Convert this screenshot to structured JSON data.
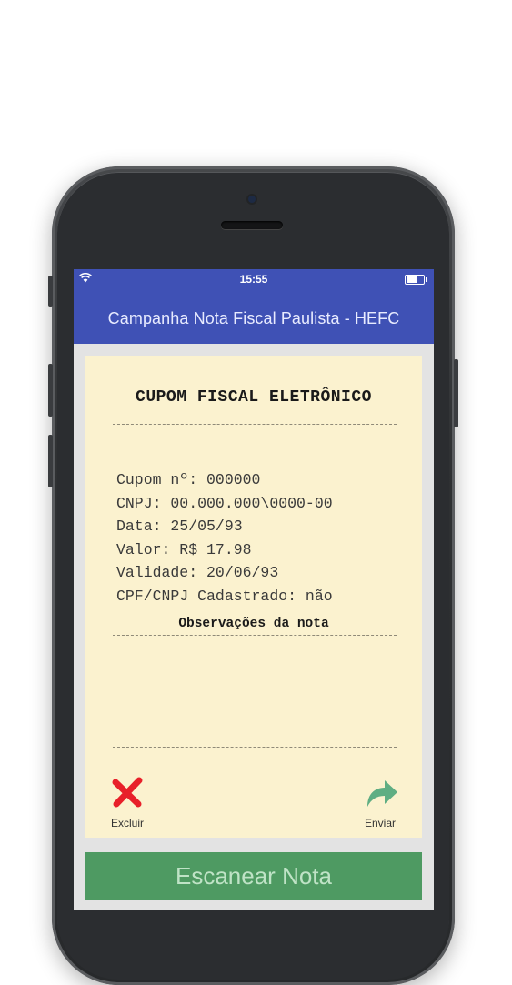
{
  "status_bar": {
    "time": "15:55",
    "icons": [
      "wifi-icon",
      "battery-icon"
    ]
  },
  "app_bar": {
    "title": "Campanha Nota Fiscal Paulista - HEFC"
  },
  "receipt": {
    "title": "CUPOM FISCAL ELETRÔNICO",
    "details": [
      "Cupom nº: 000000",
      "CNPJ: 00.000.000\\0000-00",
      "Data: 25/05/93",
      "Valor: R$ 17.98",
      "Validade: 20/06/93",
      "CPF/CNPJ Cadastrado: não"
    ],
    "observations_title": "Observações da nota",
    "actions": {
      "delete": {
        "label": "Excluir",
        "icon": "close-icon",
        "color": "#e8202a"
      },
      "send": {
        "label": "Enviar",
        "icon": "share-arrow-icon",
        "color": "#5fae83"
      }
    }
  },
  "scan_button": {
    "label": "Escanear Nota"
  },
  "colors": {
    "primary": "#3f51b5",
    "receipt_bg": "#fbf2cf",
    "scan_button": "#4e9a62"
  }
}
